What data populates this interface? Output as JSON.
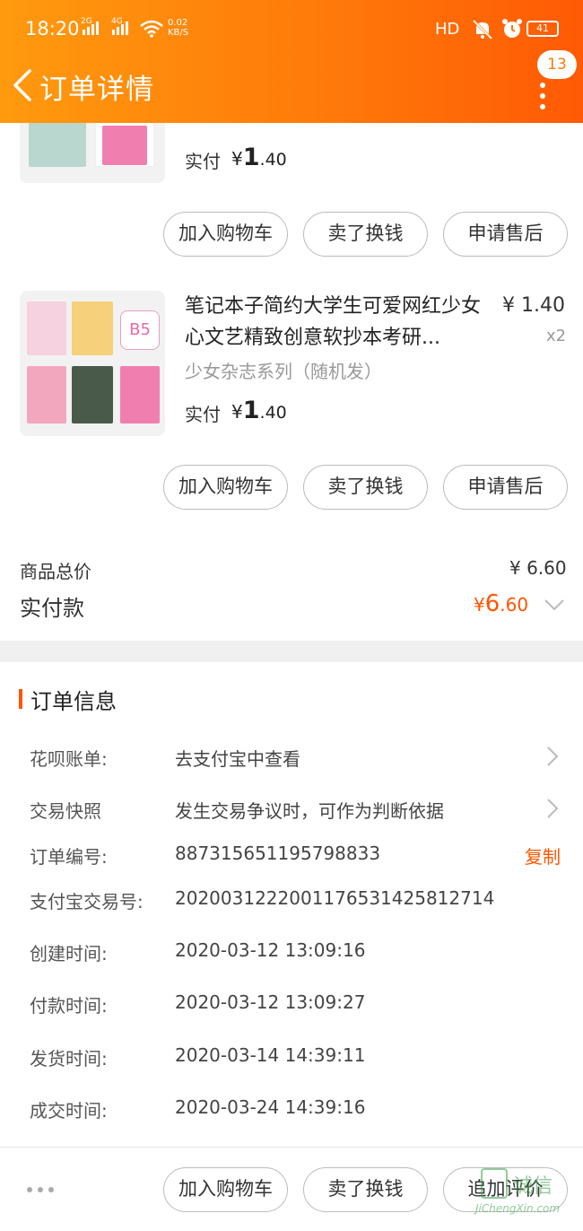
{
  "status_bar": {
    "time": "18:20",
    "signal1": "2G",
    "signal2": "4G",
    "net_speed_value": "0.02",
    "net_speed_unit": "KB/S",
    "hd": "HD",
    "battery": "41"
  },
  "header": {
    "title": "订单详情",
    "badge_count": "13"
  },
  "product_top": {
    "paid_label": "实付",
    "paid_symbol": "¥",
    "paid_int": "1",
    "paid_dec": ".40"
  },
  "product_second": {
    "title": "笔记本子简约大学生可爱网红少女心文艺精致创意软抄本考研...",
    "subtitle": "少女杂志系列（随机发）",
    "price": "¥ 1.40",
    "quantity": "x2",
    "paid_label": "实付",
    "paid_symbol": "¥",
    "paid_int": "1",
    "paid_dec": ".40",
    "thumb_badge": "B5"
  },
  "actions": {
    "add_cart": "加入购物车",
    "sell": "卖了换钱",
    "after_sale": "申请售后",
    "add_review": "追加评价"
  },
  "totals": {
    "goods_total_label": "商品总价",
    "goods_total_value": "¥ 6.60",
    "paid_label": "实付款",
    "paid_symbol": "¥",
    "paid_int": "6",
    "paid_dec": ".60"
  },
  "order_info": {
    "section_title": "订单信息",
    "rows": [
      {
        "key": "花呗账单:",
        "value": "去支付宝中查看"
      },
      {
        "key": "交易快照",
        "value": "发生交易争议时，可作为判断依据"
      },
      {
        "key": "订单编号:",
        "value": "887315651195798833",
        "action": "复制"
      },
      {
        "key": "支付宝交易号:",
        "value": "2020031222001176531425812714"
      },
      {
        "key": "创建时间:",
        "value": "2020-03-12 13:09:16"
      },
      {
        "key": "付款时间:",
        "value": "2020-03-12 13:09:27"
      },
      {
        "key": "发货时间:",
        "value": "2020-03-14 14:39:11"
      },
      {
        "key": "成交时间:",
        "value": "2020-03-24 14:39:16"
      }
    ]
  },
  "watermark": {
    "text": "诚信",
    "url": "JiChengXin.com"
  },
  "colors": {
    "accent": "#ff5500",
    "header_start": "#ff9a0e",
    "header_end": "#ff5a05"
  }
}
